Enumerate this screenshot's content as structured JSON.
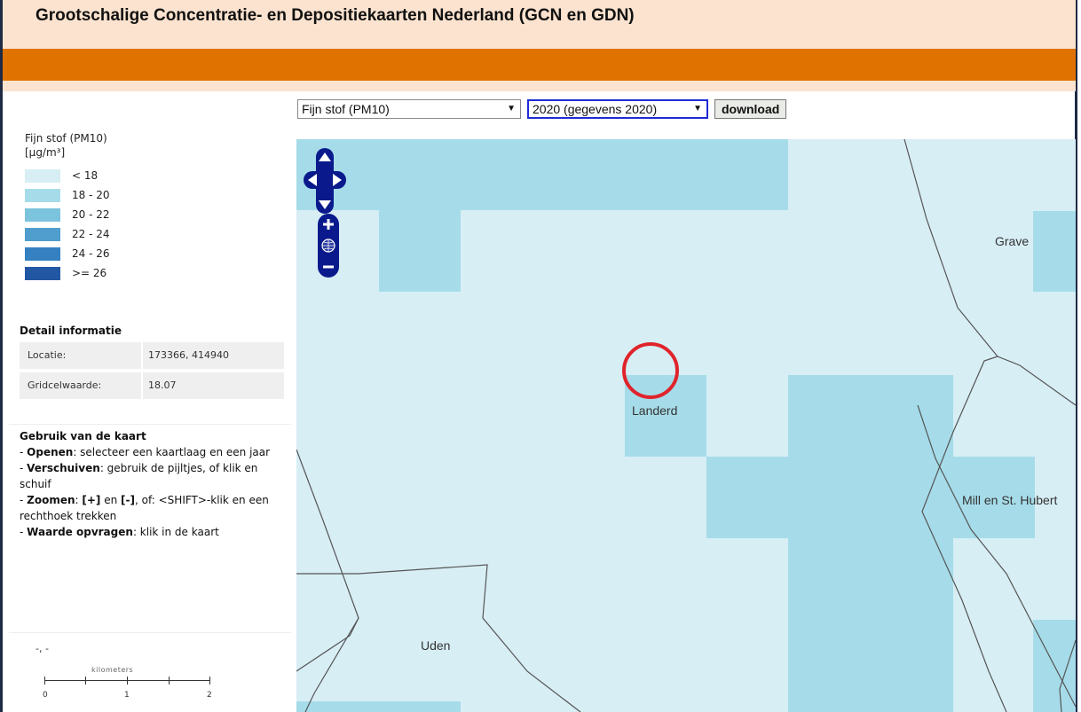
{
  "header": {
    "title": "Grootschalige Concentratie- en Depositiekaarten Nederland (GCN en GDN)"
  },
  "toolbar": {
    "layer_select": "Fijn stof (PM10)",
    "year_select": "2020 (gegevens 2020)",
    "download_label": "download"
  },
  "legend": {
    "title_line1": "Fijn stof (PM10)",
    "title_line2": "[µg/m³]",
    "items": [
      {
        "label": "< 18",
        "color": "#d7eef5"
      },
      {
        "label": "18 - 20",
        "color": "#a6dce9"
      },
      {
        "label": "20 - 22",
        "color": "#7cc3dd"
      },
      {
        "label": "22 - 24",
        "color": "#4f9ecd"
      },
      {
        "label": "24 - 26",
        "color": "#3480c0"
      },
      {
        "label": ">= 26",
        "color": "#2257a3"
      }
    ]
  },
  "detail": {
    "heading": "Detail informatie",
    "location_label": "Locatie:",
    "location_value": "173366, 414940",
    "value_label": "Gridcelwaarde:",
    "value_value": "18.07"
  },
  "usage": {
    "heading": "Gebruik van de kaart",
    "open_key": "Openen",
    "open_text": ": selecteer een kaartlaag en een jaar",
    "move_key": "Verschuiven",
    "move_text": ": gebruik de pijltjes, of klik en schuif",
    "zoom_key": "Zoomen",
    "zoom_plus": "[+]",
    "zoom_and": " en ",
    "zoom_minus": "[-]",
    "zoom_text": ", of: <SHIFT>-klik en een rechthoek trekken",
    "query_key": "Waarde opvragen",
    "query_text": ": klik in de kaart"
  },
  "coords": "-, -",
  "scale": {
    "label": "kilometers",
    "ticks": [
      "0",
      "1",
      "2"
    ]
  },
  "map": {
    "places": [
      "Grave",
      "Landerd",
      "Mill en St. Hubert",
      "Uden"
    ]
  },
  "colors": {
    "header_bg": "#fbe3cf",
    "orange_bar": "#e07300",
    "nav_blue": "#0a1a8c",
    "marker_red": "#e0242c"
  }
}
